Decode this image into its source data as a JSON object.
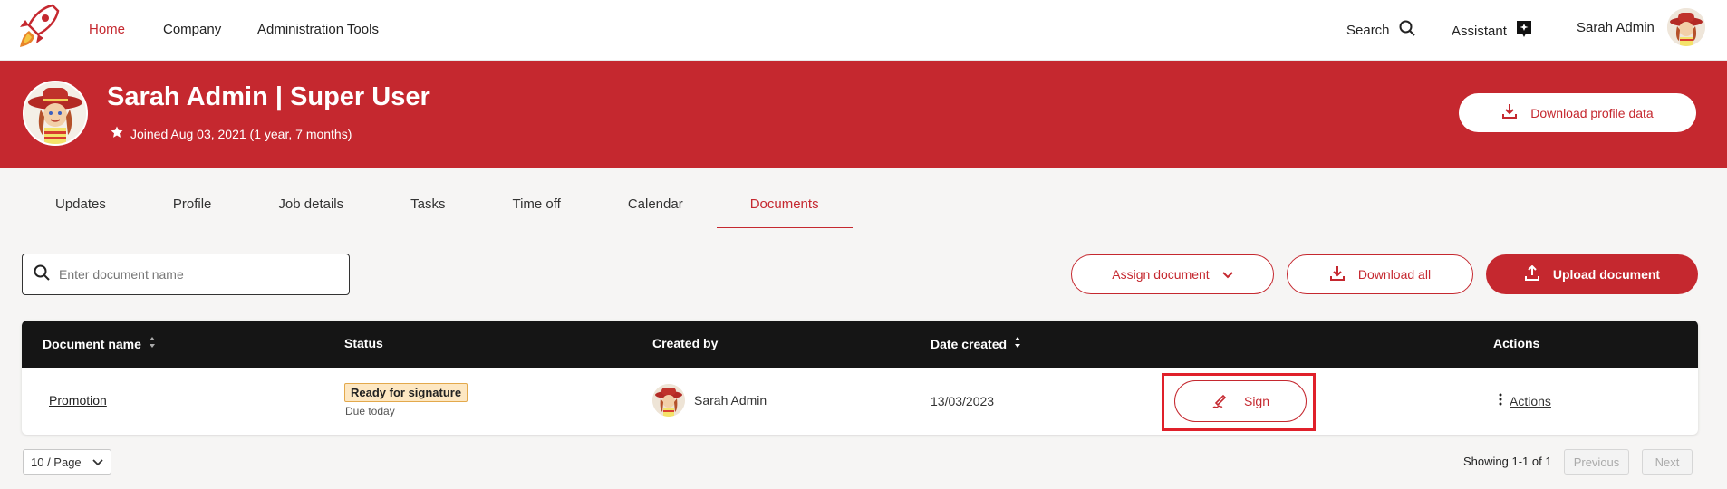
{
  "colors": {
    "brand": "#c5282f",
    "table_header": "#151515",
    "badge_bg": "#fde7c2"
  },
  "nav": {
    "logo_icon": "rocket-logo",
    "links": [
      {
        "label": "Home",
        "active": true
      },
      {
        "label": "Company",
        "active": false
      },
      {
        "label": "Administration Tools",
        "active": false
      }
    ],
    "search_label": "Search",
    "assistant_label": "Assistant",
    "user_name": "Sarah Admin"
  },
  "profile": {
    "title": "Sarah Admin | Super User",
    "joined": "Joined Aug 03, 2021 (1 year, 7 months)",
    "download_label": "Download profile data"
  },
  "tabs": [
    {
      "label": "Updates",
      "active": false
    },
    {
      "label": "Profile",
      "active": false
    },
    {
      "label": "Job details",
      "active": false
    },
    {
      "label": "Tasks",
      "active": false
    },
    {
      "label": "Time off",
      "active": false
    },
    {
      "label": "Calendar",
      "active": false
    },
    {
      "label": "Documents",
      "active": true
    }
  ],
  "toolbar": {
    "search_placeholder": "Enter document name",
    "assign_label": "Assign document",
    "download_all_label": "Download all",
    "upload_label": "Upload document"
  },
  "table": {
    "columns": {
      "name": "Document name",
      "status": "Status",
      "created_by": "Created by",
      "date_created": "Date created",
      "actions": "Actions"
    },
    "rows": [
      {
        "name": "Promotion",
        "status": "Ready for signature",
        "status_note": "Due today",
        "created_by": "Sarah Admin",
        "date_created": "13/03/2023",
        "sign_label": "Sign",
        "actions_label": "Actions"
      }
    ]
  },
  "pagination": {
    "page_size": "10 / Page",
    "showing": "Showing 1-1 of 1",
    "previous": "Previous",
    "next": "Next"
  }
}
